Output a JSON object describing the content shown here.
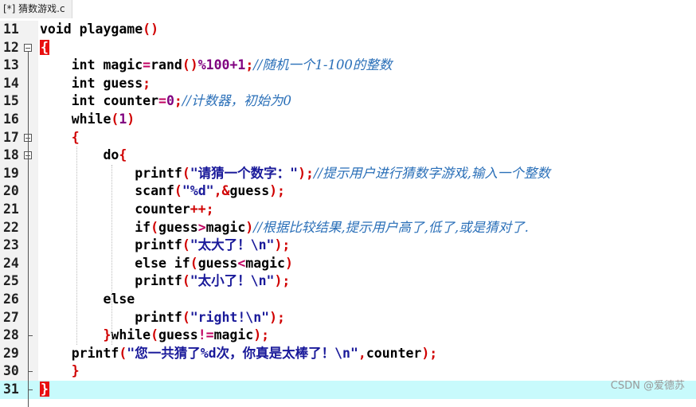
{
  "tab": {
    "title": "[*] 猜数游戏.c"
  },
  "watermark": "CSDN @爱德苏",
  "colors": {
    "current_line": "#c8fafc",
    "brace_highlight": "#e81010",
    "comment": "#2a6fb8",
    "string": "#1a1a9a",
    "punct": "#d00000"
  },
  "lines": [
    {
      "n": "11",
      "tokens": [
        [
          "kw",
          "void playgame"
        ],
        [
          "p",
          "()"
        ]
      ]
    },
    {
      "n": "12",
      "tokens": [
        [
          "brace",
          "{"
        ]
      ]
    },
    {
      "n": "13",
      "tokens": [
        [
          "kw",
          "    int magic"
        ],
        [
          "op",
          "="
        ],
        [
          "kw",
          "rand"
        ],
        [
          "p",
          "()"
        ],
        [
          "num",
          "%100+1"
        ],
        [
          "p",
          ";"
        ],
        [
          "cm",
          "//随机一个1-100的整数"
        ]
      ]
    },
    {
      "n": "14",
      "tokens": [
        [
          "kw",
          "    int guess"
        ],
        [
          "p",
          ";"
        ]
      ]
    },
    {
      "n": "15",
      "tokens": [
        [
          "kw",
          "    int counter"
        ],
        [
          "op",
          "="
        ],
        [
          "num",
          "0"
        ],
        [
          "p",
          ";"
        ],
        [
          "cm",
          "//计数器，初始为0"
        ]
      ]
    },
    {
      "n": "16",
      "tokens": [
        [
          "kw",
          "    while"
        ],
        [
          "p",
          "("
        ],
        [
          "num",
          "1"
        ],
        [
          "p",
          ")"
        ]
      ]
    },
    {
      "n": "17",
      "tokens": [
        [
          "p",
          "    {"
        ]
      ]
    },
    {
      "n": "18",
      "tokens": [
        [
          "kw",
          "        do"
        ],
        [
          "p",
          "{"
        ]
      ]
    },
    {
      "n": "19",
      "tokens": [
        [
          "kw",
          "            printf"
        ],
        [
          "p",
          "("
        ],
        [
          "str",
          "\"请猜一个数字：\""
        ],
        [
          "p",
          ");"
        ],
        [
          "cm",
          "//提示用户进行猜数字游戏,输入一个整数"
        ]
      ]
    },
    {
      "n": "20",
      "tokens": [
        [
          "kw",
          "            scanf"
        ],
        [
          "p",
          "("
        ],
        [
          "str",
          "\"%d\""
        ],
        [
          "p",
          ",&"
        ],
        [
          "kw",
          "guess"
        ],
        [
          "p",
          ");"
        ]
      ]
    },
    {
      "n": "21",
      "tokens": [
        [
          "kw",
          "            counter"
        ],
        [
          "p",
          "++;"
        ]
      ]
    },
    {
      "n": "22",
      "tokens": [
        [
          "kw",
          "            if"
        ],
        [
          "p",
          "("
        ],
        [
          "kw",
          "guess"
        ],
        [
          "op",
          ">"
        ],
        [
          "kw",
          "magic"
        ],
        [
          "p",
          ")"
        ],
        [
          "cm",
          "//根据比较结果,提示用户高了,低了,或是猜对了."
        ]
      ]
    },
    {
      "n": "23",
      "tokens": [
        [
          "kw",
          "            printf"
        ],
        [
          "p",
          "("
        ],
        [
          "str",
          "\"太大了！\\n\""
        ],
        [
          "p",
          ");"
        ]
      ]
    },
    {
      "n": "24",
      "tokens": [
        [
          "kw",
          "            else if"
        ],
        [
          "p",
          "("
        ],
        [
          "kw",
          "guess"
        ],
        [
          "op",
          "<"
        ],
        [
          "kw",
          "magic"
        ],
        [
          "p",
          ")"
        ]
      ]
    },
    {
      "n": "25",
      "tokens": [
        [
          "kw",
          "            printf"
        ],
        [
          "p",
          "("
        ],
        [
          "str",
          "\"太小了！\\n\""
        ],
        [
          "p",
          ");"
        ]
      ]
    },
    {
      "n": "26",
      "tokens": [
        [
          "kw",
          "        else"
        ]
      ]
    },
    {
      "n": "27",
      "tokens": [
        [
          "kw",
          "            printf"
        ],
        [
          "p",
          "("
        ],
        [
          "str",
          "\"right!\\n\""
        ],
        [
          "p",
          ");"
        ]
      ]
    },
    {
      "n": "28",
      "tokens": [
        [
          "p",
          "        }"
        ],
        [
          "kw",
          "while"
        ],
        [
          "p",
          "("
        ],
        [
          "kw",
          "guess"
        ],
        [
          "op",
          "!="
        ],
        [
          "kw",
          "magic"
        ],
        [
          "p",
          ");"
        ]
      ]
    },
    {
      "n": "29",
      "tokens": [
        [
          "kw",
          "    printf"
        ],
        [
          "p",
          "("
        ],
        [
          "str",
          "\"您一共猜了%d次，你真是太棒了！\\n\""
        ],
        [
          "p",
          ","
        ],
        [
          "kw",
          "counter"
        ],
        [
          "p",
          ");"
        ]
      ]
    },
    {
      "n": "30",
      "tokens": [
        [
          "p",
          "    }"
        ]
      ]
    },
    {
      "n": "31",
      "tokens": [
        [
          "brace",
          "}"
        ]
      ]
    }
  ]
}
